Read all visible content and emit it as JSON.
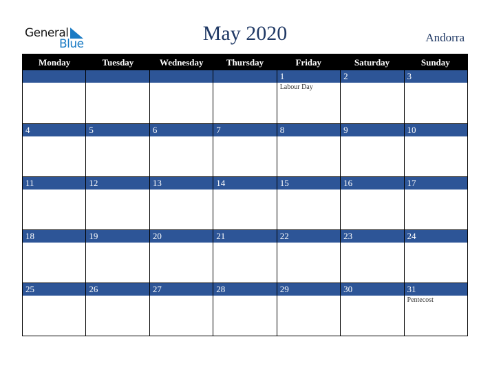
{
  "logo": {
    "line1": "General",
    "line2": "Blue"
  },
  "title": "May 2020",
  "country": "Andorra",
  "weekdays": [
    "Monday",
    "Tuesday",
    "Wednesday",
    "Thursday",
    "Friday",
    "Saturday",
    "Sunday"
  ],
  "weeks": [
    [
      {
        "day": "",
        "event": ""
      },
      {
        "day": "",
        "event": ""
      },
      {
        "day": "",
        "event": ""
      },
      {
        "day": "",
        "event": ""
      },
      {
        "day": "1",
        "event": "Labour Day"
      },
      {
        "day": "2",
        "event": ""
      },
      {
        "day": "3",
        "event": ""
      }
    ],
    [
      {
        "day": "4",
        "event": ""
      },
      {
        "day": "5",
        "event": ""
      },
      {
        "day": "6",
        "event": ""
      },
      {
        "day": "7",
        "event": ""
      },
      {
        "day": "8",
        "event": ""
      },
      {
        "day": "9",
        "event": ""
      },
      {
        "day": "10",
        "event": ""
      }
    ],
    [
      {
        "day": "11",
        "event": ""
      },
      {
        "day": "12",
        "event": ""
      },
      {
        "day": "13",
        "event": ""
      },
      {
        "day": "14",
        "event": ""
      },
      {
        "day": "15",
        "event": ""
      },
      {
        "day": "16",
        "event": ""
      },
      {
        "day": "17",
        "event": ""
      }
    ],
    [
      {
        "day": "18",
        "event": ""
      },
      {
        "day": "19",
        "event": ""
      },
      {
        "day": "20",
        "event": ""
      },
      {
        "day": "21",
        "event": ""
      },
      {
        "day": "22",
        "event": ""
      },
      {
        "day": "23",
        "event": ""
      },
      {
        "day": "24",
        "event": ""
      }
    ],
    [
      {
        "day": "25",
        "event": ""
      },
      {
        "day": "26",
        "event": ""
      },
      {
        "day": "27",
        "event": ""
      },
      {
        "day": "28",
        "event": ""
      },
      {
        "day": "29",
        "event": ""
      },
      {
        "day": "30",
        "event": ""
      },
      {
        "day": "31",
        "event": "Pentecost"
      }
    ]
  ],
  "colors": {
    "band": "#2d5597",
    "title": "#1f3864",
    "logo_blue": "#1a7bc4",
    "header_bg": "#000000"
  }
}
